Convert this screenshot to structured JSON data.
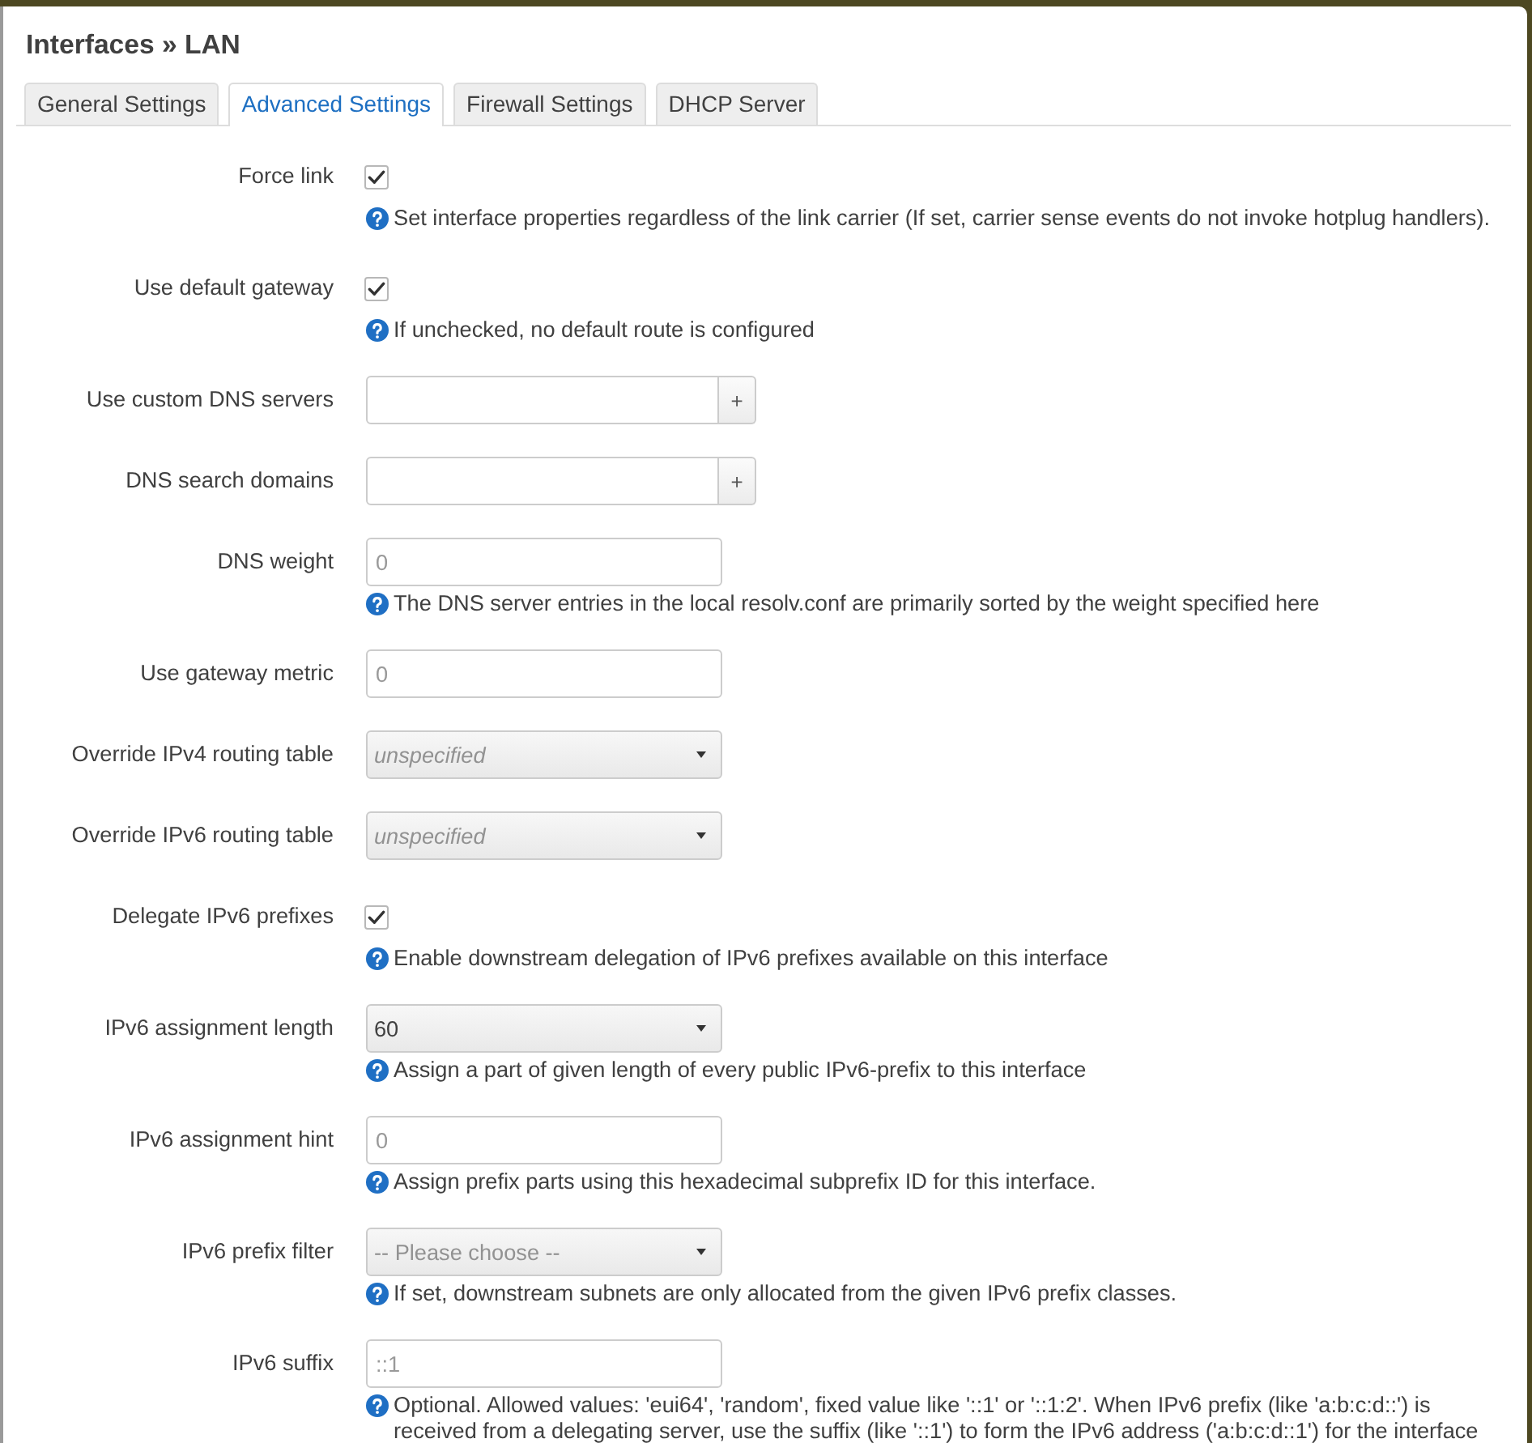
{
  "title": "Interfaces » LAN",
  "tabs": [
    {
      "label": "General Settings",
      "selected": false
    },
    {
      "label": "Advanced Settings",
      "selected": true
    },
    {
      "label": "Firewall Settings",
      "selected": false
    },
    {
      "label": "DHCP Server",
      "selected": false
    }
  ],
  "fields": [
    {
      "label": "Force link",
      "kind": "checkbox",
      "checked": true,
      "description": "Set interface properties regardless of the link carrier (If set, carrier sense events do not invoke hotplug handlers)."
    },
    {
      "label": "Use default gateway",
      "kind": "checkbox",
      "checked": true,
      "description": "If unchecked, no default route is configured"
    },
    {
      "label": "Use custom DNS servers",
      "kind": "list",
      "add_button": "+"
    },
    {
      "label": "DNS search domains",
      "kind": "list",
      "add_button": "+"
    },
    {
      "label": "DNS weight",
      "kind": "text",
      "placeholder": "0",
      "description": "The DNS server entries in the local resolv.conf are primarily sorted by the weight specified here"
    },
    {
      "label": "Use gateway metric",
      "kind": "text",
      "placeholder": "0"
    },
    {
      "label": "Override IPv4 routing table",
      "kind": "select",
      "placeholder": "unspecified",
      "unset": true
    },
    {
      "label": "Override IPv6 routing table",
      "kind": "select",
      "placeholder": "unspecified",
      "unset": true
    },
    {
      "label": "Delegate IPv6 prefixes",
      "kind": "checkbox",
      "checked": true,
      "description": "Enable downstream delegation of IPv6 prefixes available on this interface"
    },
    {
      "label": "IPv6 assignment length",
      "kind": "select",
      "value": "60",
      "description": "Assign a part of given length of every public IPv6-prefix to this interface"
    },
    {
      "label": "IPv6 assignment hint",
      "kind": "text",
      "placeholder": "0",
      "description": "Assign prefix parts using this hexadecimal subprefix ID for this interface."
    },
    {
      "label": "IPv6 prefix filter",
      "kind": "select",
      "placeholder": "-- Please choose --",
      "unset": false,
      "description": "If set, downstream subnets are only allocated from the given IPv6 prefix classes."
    },
    {
      "label": "IPv6 suffix",
      "kind": "text",
      "placeholder": "::1",
      "description": "Optional. Allowed values: 'eui64', 'random', fixed value like '::1' or '::1:2'. When IPv6 prefix (like 'a:b:c:d::') is received from a delegating server, use the suffix (like '::1') to form the IPv6 address ('a:b:c:d::1') for the interface"
    }
  ]
}
